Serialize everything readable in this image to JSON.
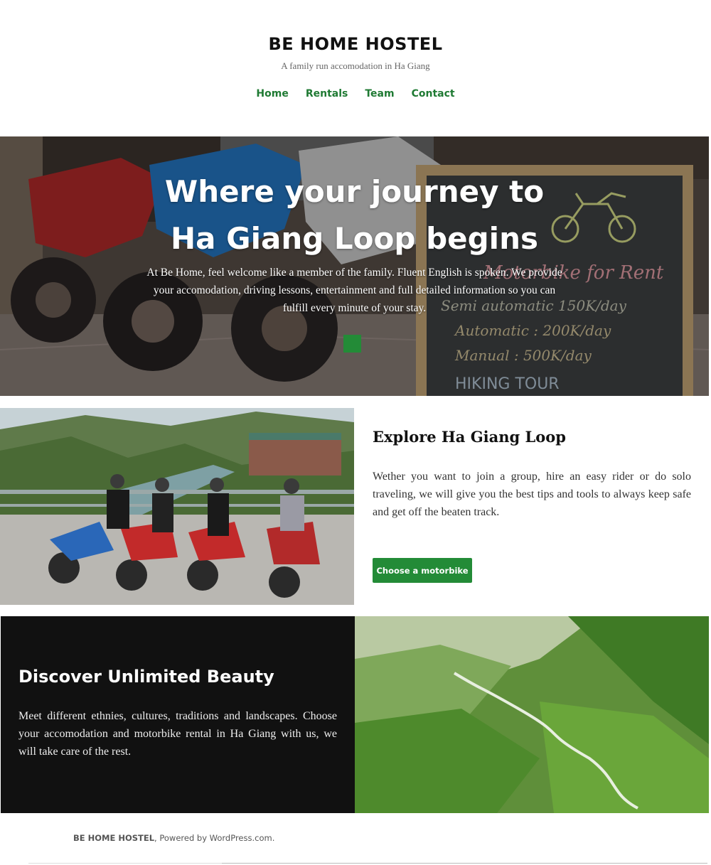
{
  "site": {
    "title": "BE HOME HOSTEL",
    "tagline": "A family run accomodation in Ha Giang"
  },
  "nav": {
    "items": [
      {
        "label": "Home"
      },
      {
        "label": "Rentals"
      },
      {
        "label": "Team"
      },
      {
        "label": "Contact"
      }
    ]
  },
  "hero": {
    "heading_line1": "Where your journey to",
    "heading_line2": "Ha Giang Loop begins",
    "text": "At Be Home, feel welcome like a member of the family. Fluent English is spoken. We provide your accomodation, driving lessons, entertainment and full detailed information so you can fulfill every minute of your stay.",
    "image_description_icon": "motorbikes-photo",
    "chalkboard": {
      "line1": "Motorbike for Rent",
      "line2": "Semi automatic 150K/day",
      "line3": "Automatic : 200K/day",
      "line4": "Manual : 500K/day",
      "line5": "HIKING TOUR"
    }
  },
  "explore": {
    "title": "Explore Ha Giang Loop",
    "text": "Wether you want to join a group, hire an easy rider or do solo traveling, we will give you the best tips and tools to always keep safe and get off the beaten track.",
    "button_label": "Choose a motorbike"
  },
  "discover": {
    "title": "Discover Unlimited Beauty",
    "text": "Meet different ethnies, cultures, traditions and landscapes. Choose your accomodation and motorbike rental in Ha Giang with us, we will take care of the rest."
  },
  "footer": {
    "brand": "BE HOME HOSTEL",
    "separator": ", ",
    "powered": "Powered by WordPress.com."
  },
  "colors": {
    "accent": "#238b37",
    "nav_link": "#1f7a33",
    "dark_panel": "#111111"
  }
}
